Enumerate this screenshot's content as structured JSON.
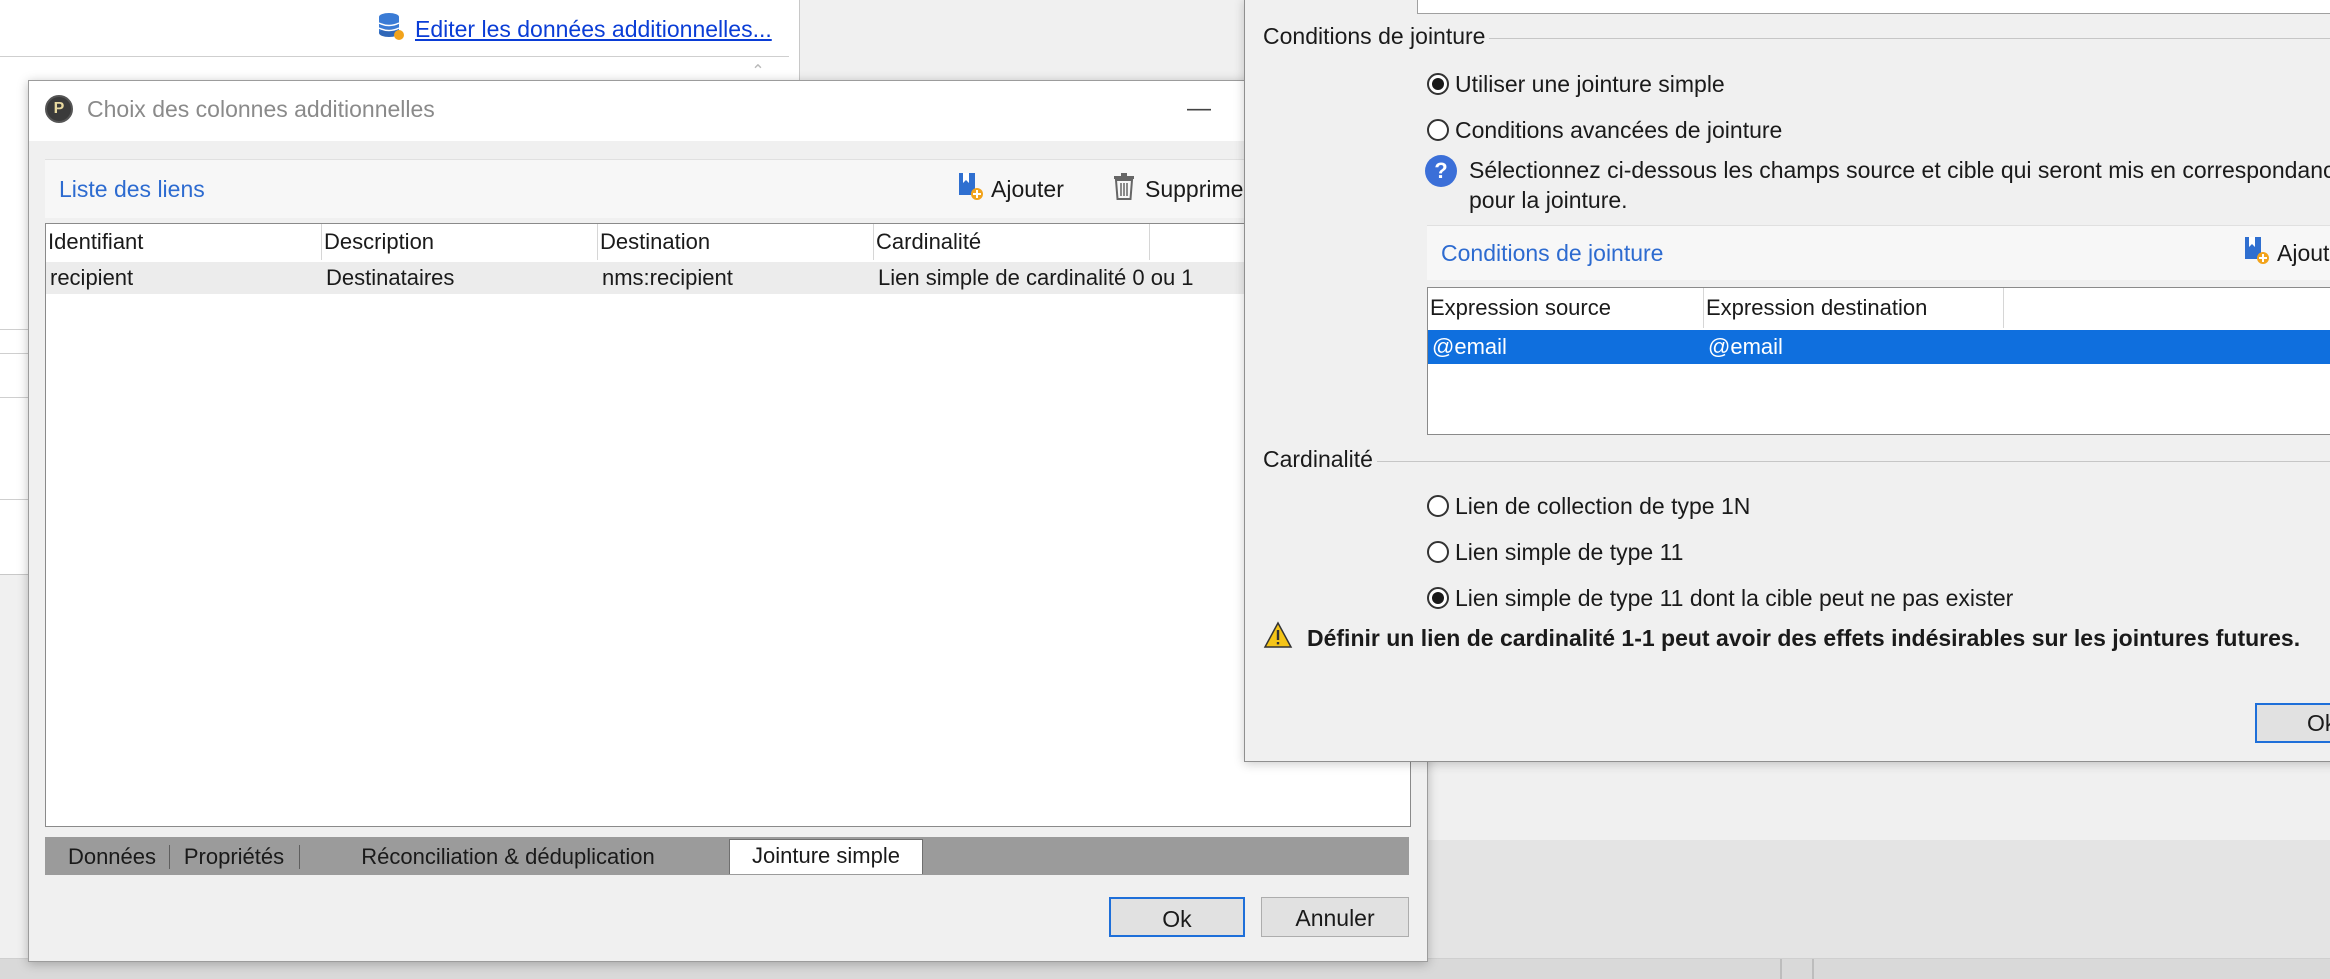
{
  "background_window": {
    "edit_link": "Editer les données additionnelles..."
  },
  "main_dialog": {
    "title": "Choix des colonnes additionnelles",
    "minimize": "—",
    "links_header": {
      "label": "Liste des liens",
      "add_label": "Ajouter",
      "delete_label": "Supprimer"
    },
    "table": {
      "columns": [
        "Identifiant",
        "Description",
        "Destination",
        "Cardinalité"
      ],
      "rows": [
        {
          "id": "recipient",
          "description": "Destinataires",
          "destination": "nms:recipient",
          "cardinality": "Lien simple de cardinalité 0 ou 1"
        }
      ]
    },
    "tabs": [
      "Données",
      "Propriétés",
      "Réconciliation & déduplication",
      "Jointure simple"
    ],
    "active_tab": "Jointure simple",
    "ok_label": "Ok",
    "cancel_label": "Annuler"
  },
  "join_dialog": {
    "join_conditions_title": "Conditions de jointure",
    "radio_simple": "Utiliser une jointure simple",
    "radio_advanced": "Conditions avancées de jointure",
    "selected_join": "Utiliser une jointure simple",
    "help_text": "Sélectionnez ci-dessous les champs source et cible qui seront mis en correspondance pour la jointure.",
    "conditions_header": {
      "label": "Conditions de jointure",
      "add_label": "Ajouter"
    },
    "conditions_table": {
      "columns": [
        "Expression source",
        "Expression destination"
      ],
      "rows": [
        {
          "source": "@email",
          "destination": "@email"
        }
      ]
    },
    "cardinality_title": "Cardinalité",
    "card_1n": "Lien de collection de type 1N",
    "card_11": "Lien simple de type 11",
    "card_11_optional": "Lien simple de type 11 dont la cible peut ne pas exister",
    "selected_cardinality": "Lien simple de type 11 dont la cible peut ne pas exister",
    "warning": "Définir un lien de cardinalité 1-1 peut avoir des effets indésirables sur les jointures futures.",
    "ok_label": "Ok"
  },
  "colors": {
    "accent_link": "#2d6bd0",
    "selection": "#0f6fde",
    "focus_border": "#1e6fd9"
  }
}
